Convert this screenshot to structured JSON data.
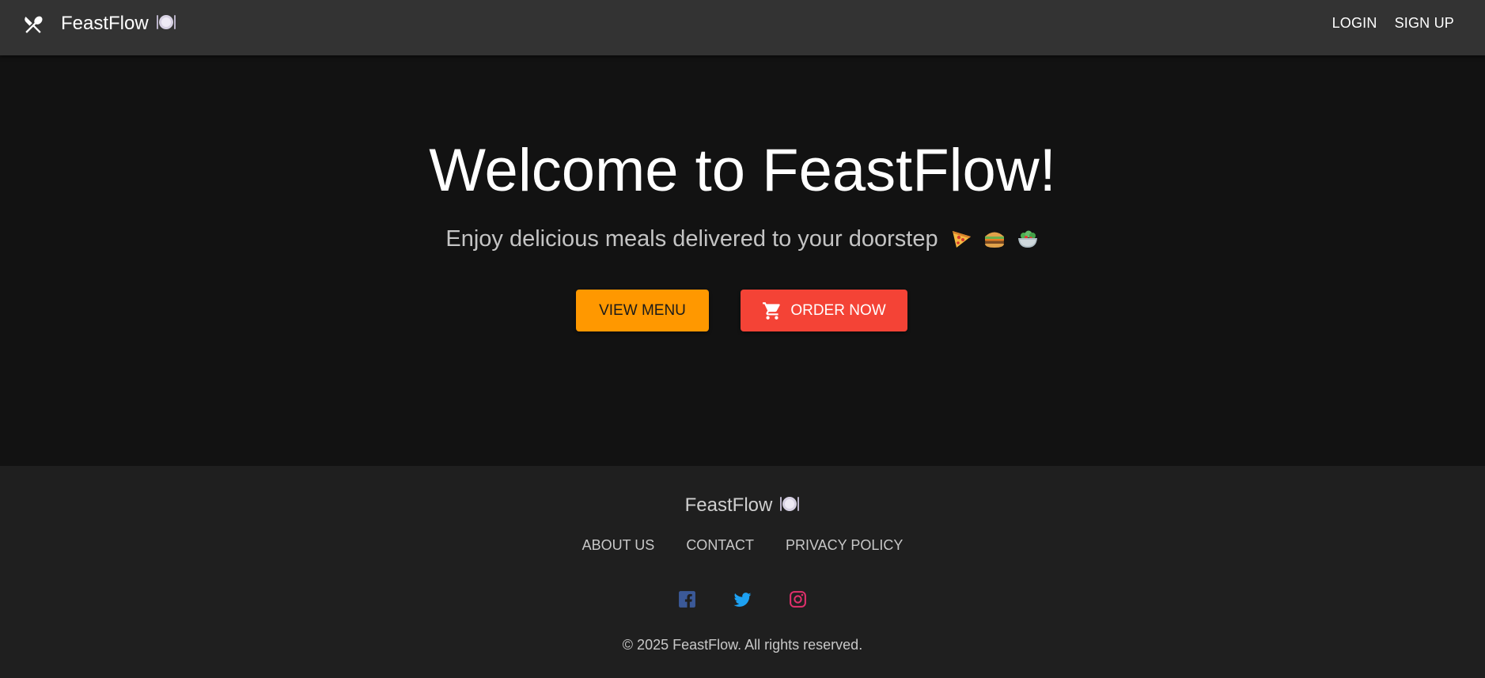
{
  "appbar": {
    "brand": "FeastFlow",
    "brand_emoji_icon": "plate-with-cutlery-icon",
    "logo_icon": "fork-and-spoon-icon",
    "nav": {
      "login": "LOGIN",
      "signup": "SIGN UP"
    }
  },
  "hero": {
    "title": "Welcome to FeastFlow!",
    "subtitle": "Enjoy delicious meals delivered to your doorstep",
    "emoji_icons": [
      "pizza-icon",
      "burger-icon",
      "salad-icon"
    ],
    "buttons": {
      "view_menu": "VIEW MENU",
      "order_now": "ORDER NOW",
      "order_icon": "cart-icon"
    }
  },
  "footer": {
    "brand": "FeastFlow",
    "links": [
      "ABOUT US",
      "CONTACT",
      "PRIVACY POLICY"
    ],
    "socials": [
      "facebook-icon",
      "twitter-icon",
      "instagram-icon"
    ],
    "copyright": "© 2025 FeastFlow. All rights reserved."
  },
  "colors": {
    "appbar": "#333333",
    "hero_bg": "#121212",
    "footer_bg": "#1f1f1f",
    "view_menu": "#ff9800",
    "order_now": "#f44336",
    "facebook": "#3b5998",
    "twitter": "#1da1f2",
    "instagram": "#e1306c"
  }
}
